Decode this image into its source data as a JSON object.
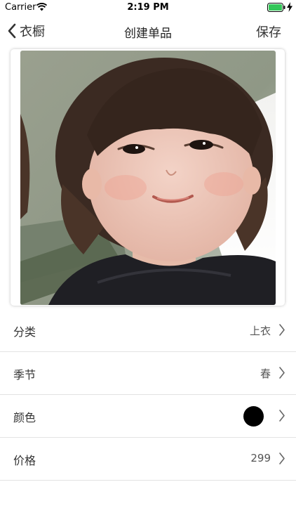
{
  "status_bar": {
    "carrier": "Carrier",
    "time": "2:19 PM",
    "icons": [
      "wifi-icon",
      "battery-icon",
      "charging-bolt-icon"
    ],
    "battery_color": "#34c759"
  },
  "nav": {
    "back_label": "衣橱",
    "title": "创建单品",
    "save_label": "保存"
  },
  "photo": {
    "content": "photo-of-child"
  },
  "rows": [
    {
      "label": "分类",
      "value": "上衣"
    },
    {
      "label": "季节",
      "value": "春"
    },
    {
      "label": "颜色",
      "color": "#000000"
    },
    {
      "label": "价格",
      "value": "299"
    }
  ]
}
